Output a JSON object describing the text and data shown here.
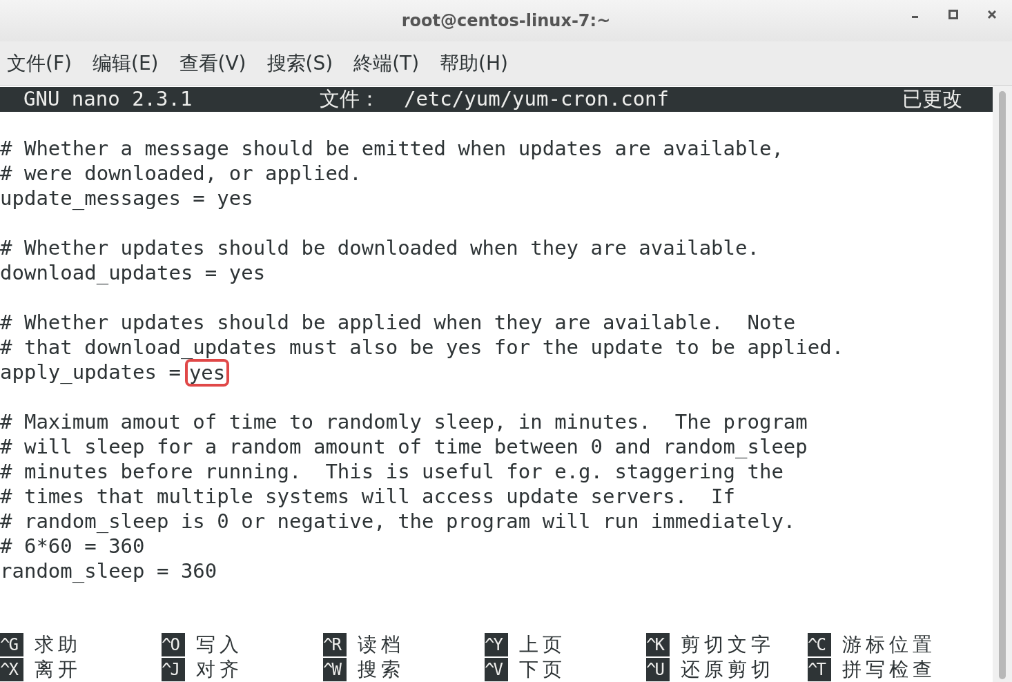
{
  "window": {
    "title": "root@centos-linux-7:~"
  },
  "menu": [
    "文件(F)",
    "编辑(E)",
    "查看(V)",
    "搜索(S)",
    "終端(T)",
    "帮助(H)"
  ],
  "nano_header": {
    "version": "GNU nano 2.3.1",
    "file": "文件：  /etc/yum/yum-cron.conf",
    "status": "已更改"
  },
  "lines": [
    {
      "kind": "blank"
    },
    {
      "kind": "text",
      "text": "# Whether a message should be emitted when updates are available,"
    },
    {
      "kind": "text",
      "text": "# were downloaded, or applied."
    },
    {
      "kind": "text",
      "text": "update_messages = yes"
    },
    {
      "kind": "blank"
    },
    {
      "kind": "text",
      "text": "# Whether updates should be downloaded when they are available."
    },
    {
      "kind": "text",
      "text": "download_updates = yes"
    },
    {
      "kind": "blank"
    },
    {
      "kind": "text",
      "text": "# Whether updates should be applied when they are available.  Note"
    },
    {
      "kind": "text",
      "text": "# that download_updates must also be yes for the update to be applied."
    },
    {
      "kind": "marked",
      "text": "apply_updates =",
      "marked": "yes"
    },
    {
      "kind": "blank"
    },
    {
      "kind": "text",
      "text": "# Maximum amout of time to randomly sleep, in minutes.  The program"
    },
    {
      "kind": "text",
      "text": "# will sleep for a random amount of time between 0 and random_sleep"
    },
    {
      "kind": "text",
      "text": "# minutes before running.  This is useful for e.g. staggering the"
    },
    {
      "kind": "text",
      "text": "# times that multiple systems will access update servers.  If"
    },
    {
      "kind": "text",
      "text": "# random_sleep is 0 or negative, the program will run immediately."
    },
    {
      "kind": "text",
      "text": "# 6*60 = 360"
    },
    {
      "kind": "text",
      "text": "random_sleep = 360"
    }
  ],
  "shortcuts": [
    [
      {
        "key": "^G",
        "label": "求助"
      },
      {
        "key": "^O",
        "label": "写入"
      },
      {
        "key": "^R",
        "label": "读档"
      },
      {
        "key": "^Y",
        "label": "上页"
      },
      {
        "key": "^K",
        "label": "剪切文字"
      },
      {
        "key": "^C",
        "label": "游标位置"
      }
    ],
    [
      {
        "key": "^X",
        "label": "离开"
      },
      {
        "key": "^J",
        "label": "对齐"
      },
      {
        "key": "^W",
        "label": "搜索"
      },
      {
        "key": "^V",
        "label": "下页"
      },
      {
        "key": "^U",
        "label": "还原剪切"
      },
      {
        "key": "^T",
        "label": "拼写检查"
      }
    ]
  ]
}
